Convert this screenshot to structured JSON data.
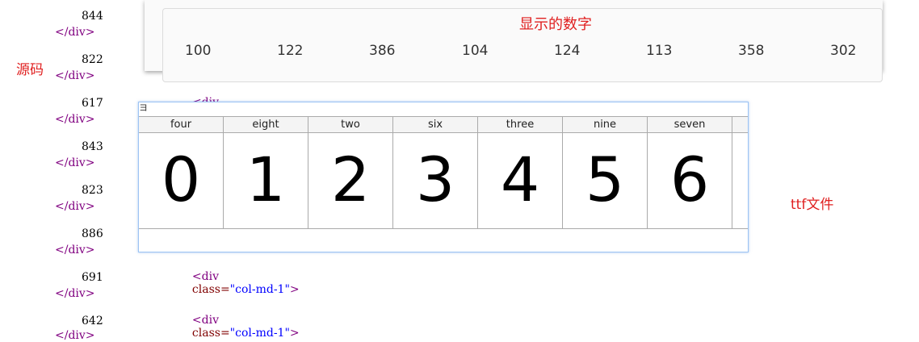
{
  "source_code": {
    "entries": [
      {
        "number": "844",
        "close_tag": "</div>"
      },
      {
        "number": "822",
        "close_tag": "</div>"
      },
      {
        "number": "617",
        "close_tag": "</div>"
      },
      {
        "number": "843",
        "close_tag": "</div>"
      },
      {
        "number": "823",
        "close_tag": "</div>"
      },
      {
        "number": "886",
        "close_tag": "</div>"
      },
      {
        "number": "691",
        "close_tag": "</div>"
      },
      {
        "number": "642",
        "close_tag": "</div>"
      }
    ],
    "div_open": "<div",
    "class_attr": "class=",
    "class_value": "\"col-md-1\"",
    "div_close_bracket": ">"
  },
  "annotations": {
    "source_label": "源码",
    "display_label": "显示的数字",
    "ttf_label": "ttf文件"
  },
  "display_panel": {
    "numbers": [
      "100",
      "122",
      "386",
      "104",
      "124",
      "113",
      "358",
      "302"
    ]
  },
  "font_viewer": {
    "corner_mark": "ヨ",
    "cells": [
      {
        "name": "four",
        "glyph": "0"
      },
      {
        "name": "eight",
        "glyph": "1"
      },
      {
        "name": "two",
        "glyph": "2"
      },
      {
        "name": "six",
        "glyph": "3"
      },
      {
        "name": "three",
        "glyph": "4"
      },
      {
        "name": "nine",
        "glyph": "5"
      },
      {
        "name": "seven",
        "glyph": "6"
      }
    ]
  },
  "colors": {
    "annotation_red": "#e02020",
    "tag_purple": "#800080",
    "attr_maroon": "#800000",
    "value_blue": "#0000ff",
    "viewer_border": "#9cc4f4"
  }
}
